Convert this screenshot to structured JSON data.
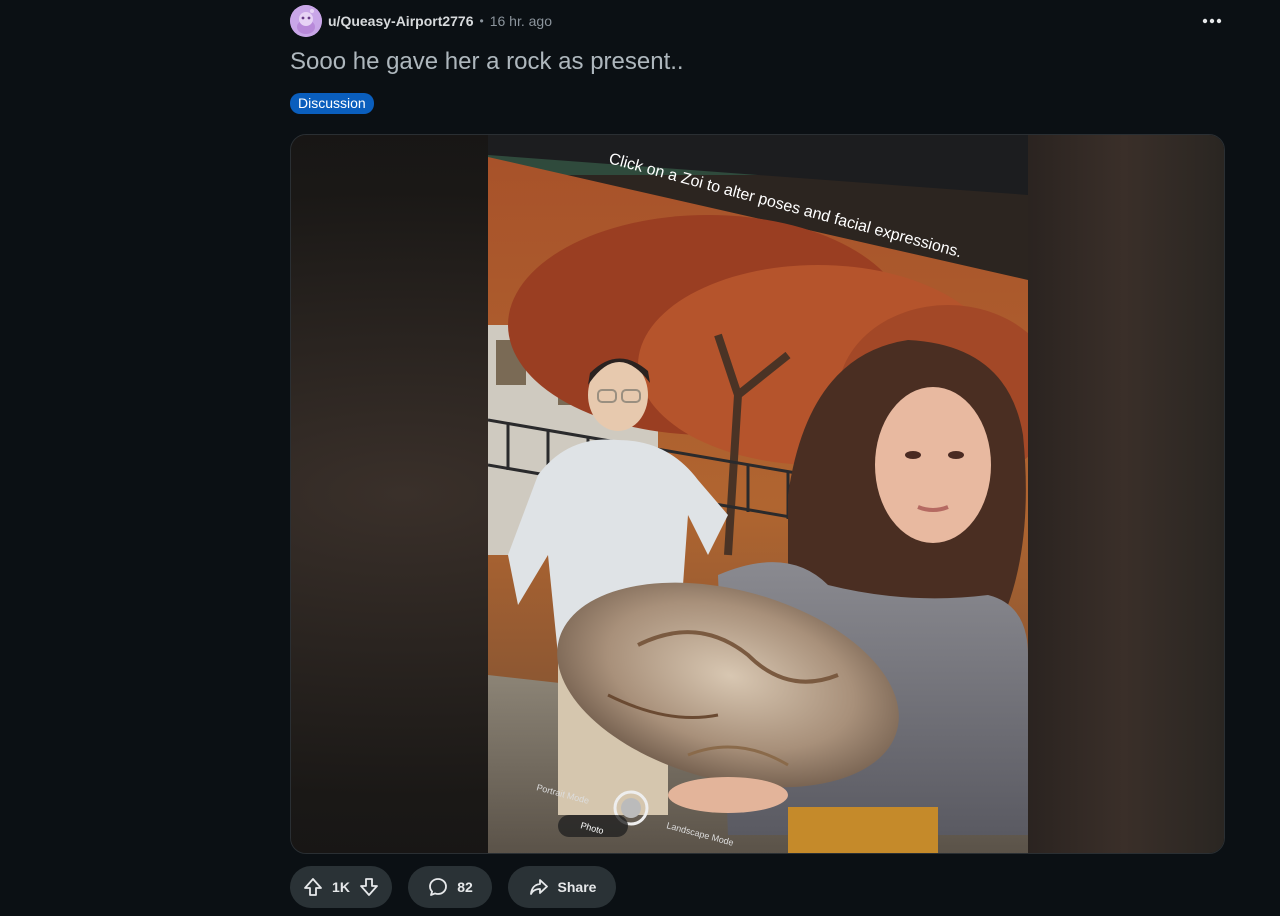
{
  "post": {
    "username": "u/Queasy-Airport2776",
    "separator": "•",
    "time": "16 hr. ago",
    "title": "Sooo he gave her a rock as present..",
    "flair": "Discussion",
    "overflow_icon": "more-horizontal-icon"
  },
  "media": {
    "overlay_text": "Click on a Zoi to alter poses and facial expressions.",
    "mode_portrait": "Portrait Mode",
    "mode_photo": "Photo",
    "mode_landscape": "Landscape Mode"
  },
  "actions": {
    "upvote_icon": "arrow-up-icon",
    "score": "1K",
    "downvote_icon": "arrow-down-icon",
    "comment_icon": "comment-icon",
    "comments": "82",
    "share_icon": "share-icon",
    "share_label": "Share"
  },
  "colors": {
    "background": "#0b1014",
    "flair": "#0a5ebd",
    "pill": "#2a3236",
    "muted": "#8b949c"
  }
}
